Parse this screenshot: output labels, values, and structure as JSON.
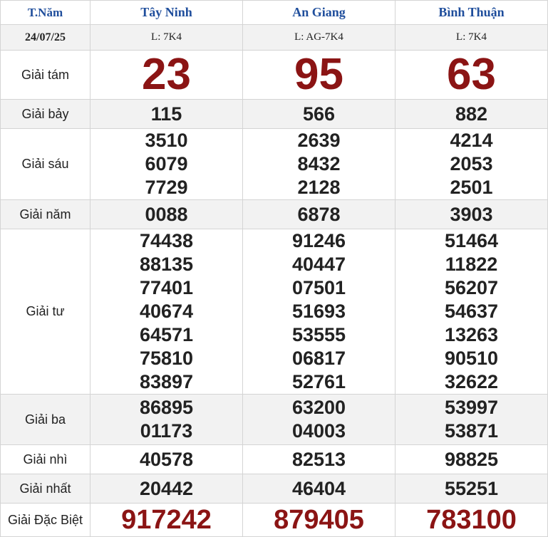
{
  "header": {
    "day_label": "T.Năm",
    "date": "24/07/25",
    "provinces": [
      {
        "name": "Tây Ninh",
        "ticket": "L: 7K4"
      },
      {
        "name": "An Giang",
        "ticket": "L: AG-7K4"
      },
      {
        "name": "Bình Thuận",
        "ticket": "L: 7K4"
      }
    ]
  },
  "prizes": {
    "g8": {
      "label": "Giải tám",
      "values": [
        "23",
        "95",
        "63"
      ]
    },
    "g7": {
      "label": "Giải bảy",
      "values": [
        "115",
        "566",
        "882"
      ]
    },
    "g6": {
      "label": "Giải sáu",
      "values": [
        [
          "3510",
          "6079",
          "7729"
        ],
        [
          "2639",
          "8432",
          "2128"
        ],
        [
          "4214",
          "2053",
          "2501"
        ]
      ]
    },
    "g5": {
      "label": "Giải năm",
      "values": [
        "0088",
        "6878",
        "3903"
      ]
    },
    "g4": {
      "label": "Giải tư",
      "values": [
        [
          "74438",
          "88135",
          "77401",
          "40674",
          "64571",
          "75810",
          "83897"
        ],
        [
          "91246",
          "40447",
          "07501",
          "51693",
          "53555",
          "06817",
          "52761"
        ],
        [
          "51464",
          "11822",
          "56207",
          "54637",
          "13263",
          "90510",
          "32622"
        ]
      ]
    },
    "g3": {
      "label": "Giải ba",
      "values": [
        [
          "86895",
          "01173"
        ],
        [
          "63200",
          "04003"
        ],
        [
          "53997",
          "53871"
        ]
      ]
    },
    "g2": {
      "label": "Giải nhì",
      "values": [
        "40578",
        "82513",
        "98825"
      ]
    },
    "g1": {
      "label": "Giải nhất",
      "values": [
        "20442",
        "46404",
        "55251"
      ]
    },
    "db": {
      "label": "Giải Đặc Biệt",
      "values": [
        "917242",
        "879405",
        "783100"
      ]
    }
  }
}
